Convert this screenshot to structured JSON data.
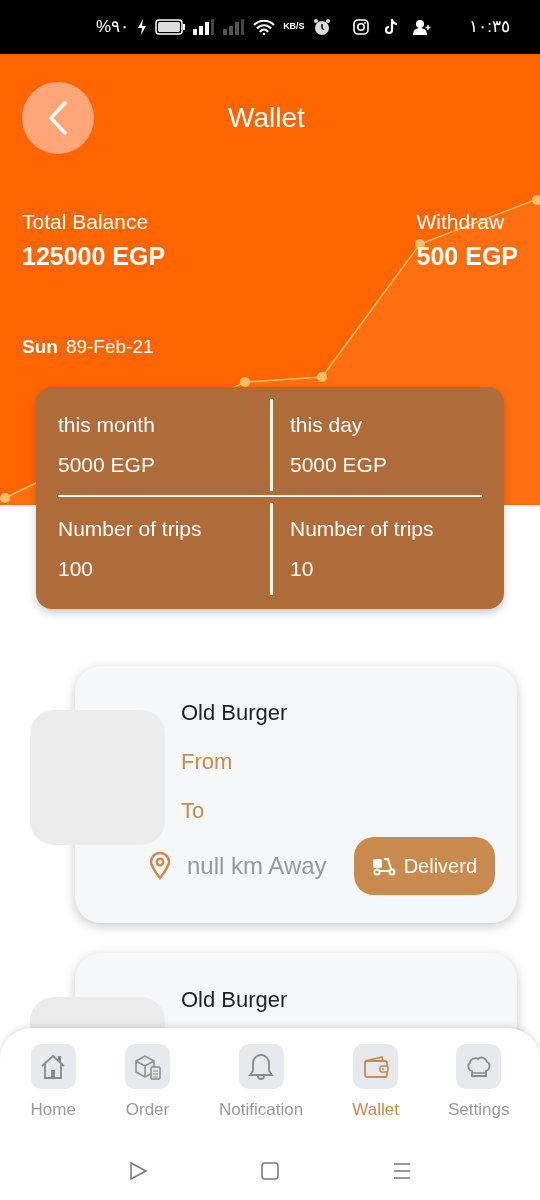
{
  "status_bar": {
    "battery": "%٩٠",
    "speed": "KB/S",
    "time": "١٠:٣٥"
  },
  "header": {
    "title": "Wallet"
  },
  "balance": {
    "label": "Total Balance",
    "value": "125000 EGP"
  },
  "withdraw": {
    "label": "Withdraw",
    "value": "500 EGP"
  },
  "date": {
    "day": "Sun",
    "date": "89-Feb-21"
  },
  "stats": [
    {
      "label": "this month",
      "value": "5000 EGP"
    },
    {
      "label": "this day",
      "value": "5000 EGP"
    },
    {
      "label": "Number of trips",
      "value": "100"
    },
    {
      "label": "Number of trips",
      "value": "10"
    }
  ],
  "orders": [
    {
      "name": "Old Burger",
      "from_label": "From",
      "to_label": "To",
      "distance": "null km Away",
      "status": "Deliverd"
    },
    {
      "name": "Old Burger"
    }
  ],
  "nav": [
    {
      "label": "Home",
      "kind": "home",
      "selected": false
    },
    {
      "label": "Order",
      "kind": "order",
      "selected": false
    },
    {
      "label": "Notification",
      "kind": "bell",
      "selected": false
    },
    {
      "label": "Wallet",
      "kind": "wallet",
      "selected": true
    },
    {
      "label": "Settings",
      "kind": "chef",
      "selected": false
    }
  ]
}
